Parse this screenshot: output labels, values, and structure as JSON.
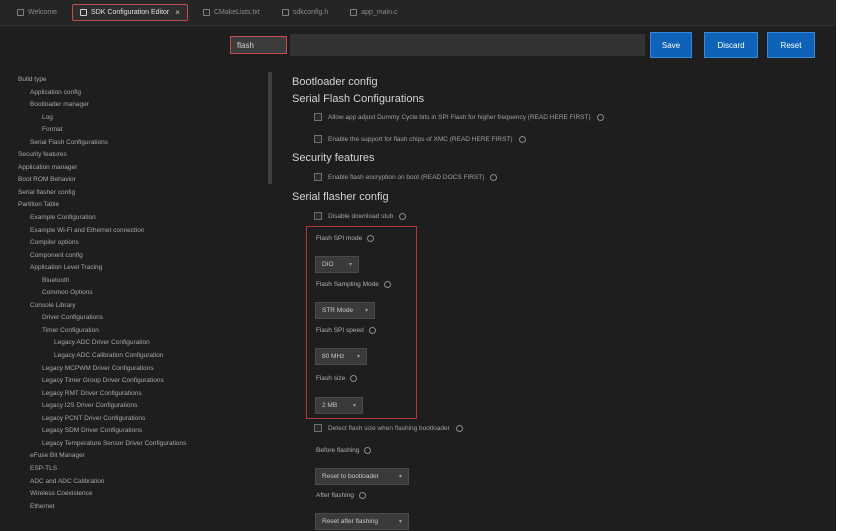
{
  "tabs": [
    {
      "label": "Welcome",
      "active": false
    },
    {
      "label": "SDK Configuration Editor",
      "active": true
    },
    {
      "label": "CMakeLists.txt",
      "active": false
    },
    {
      "label": "sdkconfig.h",
      "active": false
    },
    {
      "label": "app_main.c",
      "active": false
    }
  ],
  "toolbar": {
    "search_value": "flash",
    "save_label": "Save",
    "discard_label": "Discard",
    "reset_label": "Reset"
  },
  "tree": [
    {
      "label": "Build type",
      "indent": 0
    },
    {
      "label": "Application config",
      "indent": 1
    },
    {
      "label": "Bootloader manager",
      "indent": 1
    },
    {
      "label": "Log",
      "indent": 2
    },
    {
      "label": "Format",
      "indent": 2
    },
    {
      "label": "Serial Flash Configurations",
      "indent": 1
    },
    {
      "label": "Security features",
      "indent": 0
    },
    {
      "label": "Application manager",
      "indent": 0
    },
    {
      "label": "Boot ROM Behavior",
      "indent": 0
    },
    {
      "label": "Serial flasher config",
      "indent": 0
    },
    {
      "label": "Partition Table",
      "indent": 0
    },
    {
      "label": "Example Configuration",
      "indent": 1
    },
    {
      "label": "Example Wi-Fi and Ethernet connection",
      "indent": 1
    },
    {
      "label": "Compiler options",
      "indent": 1
    },
    {
      "label": "Component config",
      "indent": 1
    },
    {
      "label": "Application Level Tracing",
      "indent": 1
    },
    {
      "label": "Bluetooth",
      "indent": 2
    },
    {
      "label": "Common Options",
      "indent": 2
    },
    {
      "label": "Console Library",
      "indent": 1
    },
    {
      "label": "Driver Configurations",
      "indent": 2
    },
    {
      "label": "Timer Configuration",
      "indent": 2
    },
    {
      "label": "Legacy ADC Driver Configuration",
      "indent": 3
    },
    {
      "label": "Legacy ADC Calibration Configuration",
      "indent": 3
    },
    {
      "label": "Legacy MCPWM Driver Configurations",
      "indent": 2
    },
    {
      "label": "Legacy Timer Group Driver Configurations",
      "indent": 2
    },
    {
      "label": "Legacy RMT Driver Configurations",
      "indent": 2
    },
    {
      "label": "Legacy I2S Driver Configurations",
      "indent": 2
    },
    {
      "label": "Legacy PCNT Driver Configurations",
      "indent": 2
    },
    {
      "label": "Legacy SDM Driver Configurations",
      "indent": 2
    },
    {
      "label": "Legacy Temperature Sensor Driver Configurations",
      "indent": 2
    },
    {
      "label": "eFuse Bit Manager",
      "indent": 1
    },
    {
      "label": "ESP-TLS",
      "indent": 1
    },
    {
      "label": "ADC and ADC Calibration",
      "indent": 1
    },
    {
      "label": "Wireless Coexistence",
      "indent": 1
    },
    {
      "label": "Ethernet",
      "indent": 1
    }
  ],
  "content": {
    "sections": {
      "bootloader": "Bootloader config",
      "serial_flash": "Serial Flash Configurations",
      "security": "Security features",
      "flasher": "Serial flasher config"
    },
    "options": {
      "opt1": "Allow app adjust Dummy Cycle bits in SPI Flash for higher frequency (READ HERE FIRST)",
      "opt2": "Enable the support for flash chips of XMC (READ HERE FIRST)",
      "opt3": "Enable flash encryption on boot (READ DOCS FIRST)",
      "opt4": "Disable download stub",
      "opt5": "Detect flash size when flashing bootloader"
    },
    "flash_box": {
      "flash_spi_mode_label": "Flash SPI mode",
      "flash_spi_mode_value": "DIO",
      "flash_sampling_mode_label": "Flash Sampling Mode",
      "flash_sampling_mode_value": "STR Mode",
      "flash_spi_speed_label": "Flash SPI speed",
      "flash_spi_speed_value": "80 MHz",
      "flash_size_label": "Flash size",
      "flash_size_value": "2 MB"
    },
    "before_flashing_label": "Before flashing",
    "before_flashing_value": "Reset to bootloader",
    "after_flashing_label": "After flashing",
    "after_flashing_value": "Reset after flashing"
  }
}
